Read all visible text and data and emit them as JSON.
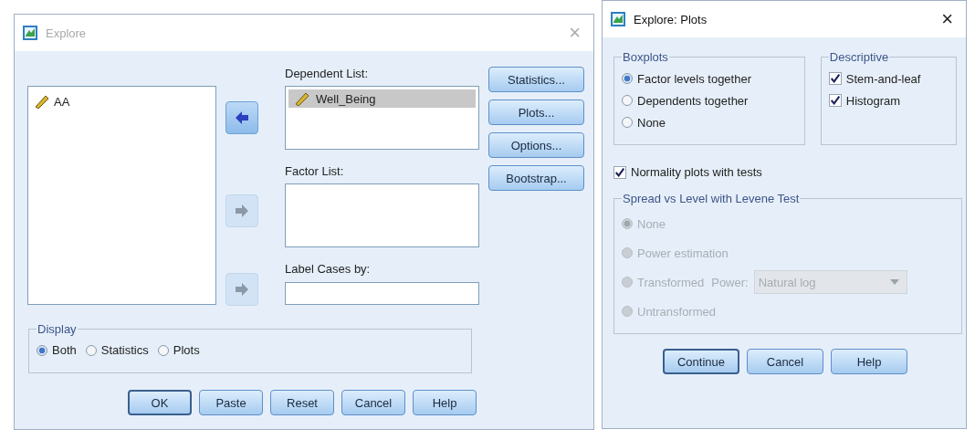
{
  "explore": {
    "title": "Explore",
    "active": false,
    "close": "×",
    "variables": [
      {
        "name": "AA"
      }
    ],
    "move_buttons": [
      {
        "disabled": false
      },
      {
        "disabled": true
      },
      {
        "disabled": true
      }
    ],
    "dependent_list": {
      "label": "Dependent List:",
      "items": [
        {
          "name": "Well_Being",
          "selected": true
        }
      ]
    },
    "factor_list": {
      "label": "Factor List:"
    },
    "label_cases": {
      "label": "Label Cases by:"
    },
    "side_buttons": [
      "Statistics...",
      "Plots...",
      "Options...",
      "Bootstrap..."
    ],
    "display": {
      "label": "Display",
      "options": [
        {
          "label": "Both",
          "selected": true
        },
        {
          "label": "Statistics",
          "selected": false
        },
        {
          "label": "Plots",
          "selected": false
        }
      ]
    },
    "buttons": [
      {
        "label": "OK",
        "default": true
      },
      {
        "label": "Paste",
        "default": false
      },
      {
        "label": "Reset",
        "default": false
      },
      {
        "label": "Cancel",
        "default": false
      },
      {
        "label": "Help",
        "default": false
      }
    ]
  },
  "plots": {
    "title": "Explore: Plots",
    "active": true,
    "close": "×",
    "boxplots": {
      "label": "Boxplots",
      "options": [
        {
          "label": "Factor levels together",
          "selected": true
        },
        {
          "label": "Dependents together",
          "selected": false
        },
        {
          "label": "None",
          "selected": false
        }
      ]
    },
    "descriptive": {
      "label": "Descriptive",
      "options": [
        {
          "label": "Stem-and-leaf",
          "checked": true
        },
        {
          "label": "Histogram",
          "checked": true
        }
      ]
    },
    "normality": {
      "label": "Normality plots with tests",
      "checked": true
    },
    "levene": {
      "label": "Spread vs Level with Levene Test",
      "disabled": true,
      "options": [
        {
          "label": "None",
          "selected": true
        },
        {
          "label": "Power estimation",
          "selected": false
        },
        {
          "label": "Transformed",
          "selected": false
        },
        {
          "label": "Untransformed",
          "selected": false
        }
      ],
      "power_label": "Power:",
      "power_value": "Natural log"
    },
    "buttons": [
      {
        "label": "Continue",
        "default": true
      },
      {
        "label": "Cancel",
        "default": false
      },
      {
        "label": "Help",
        "default": false
      }
    ]
  }
}
